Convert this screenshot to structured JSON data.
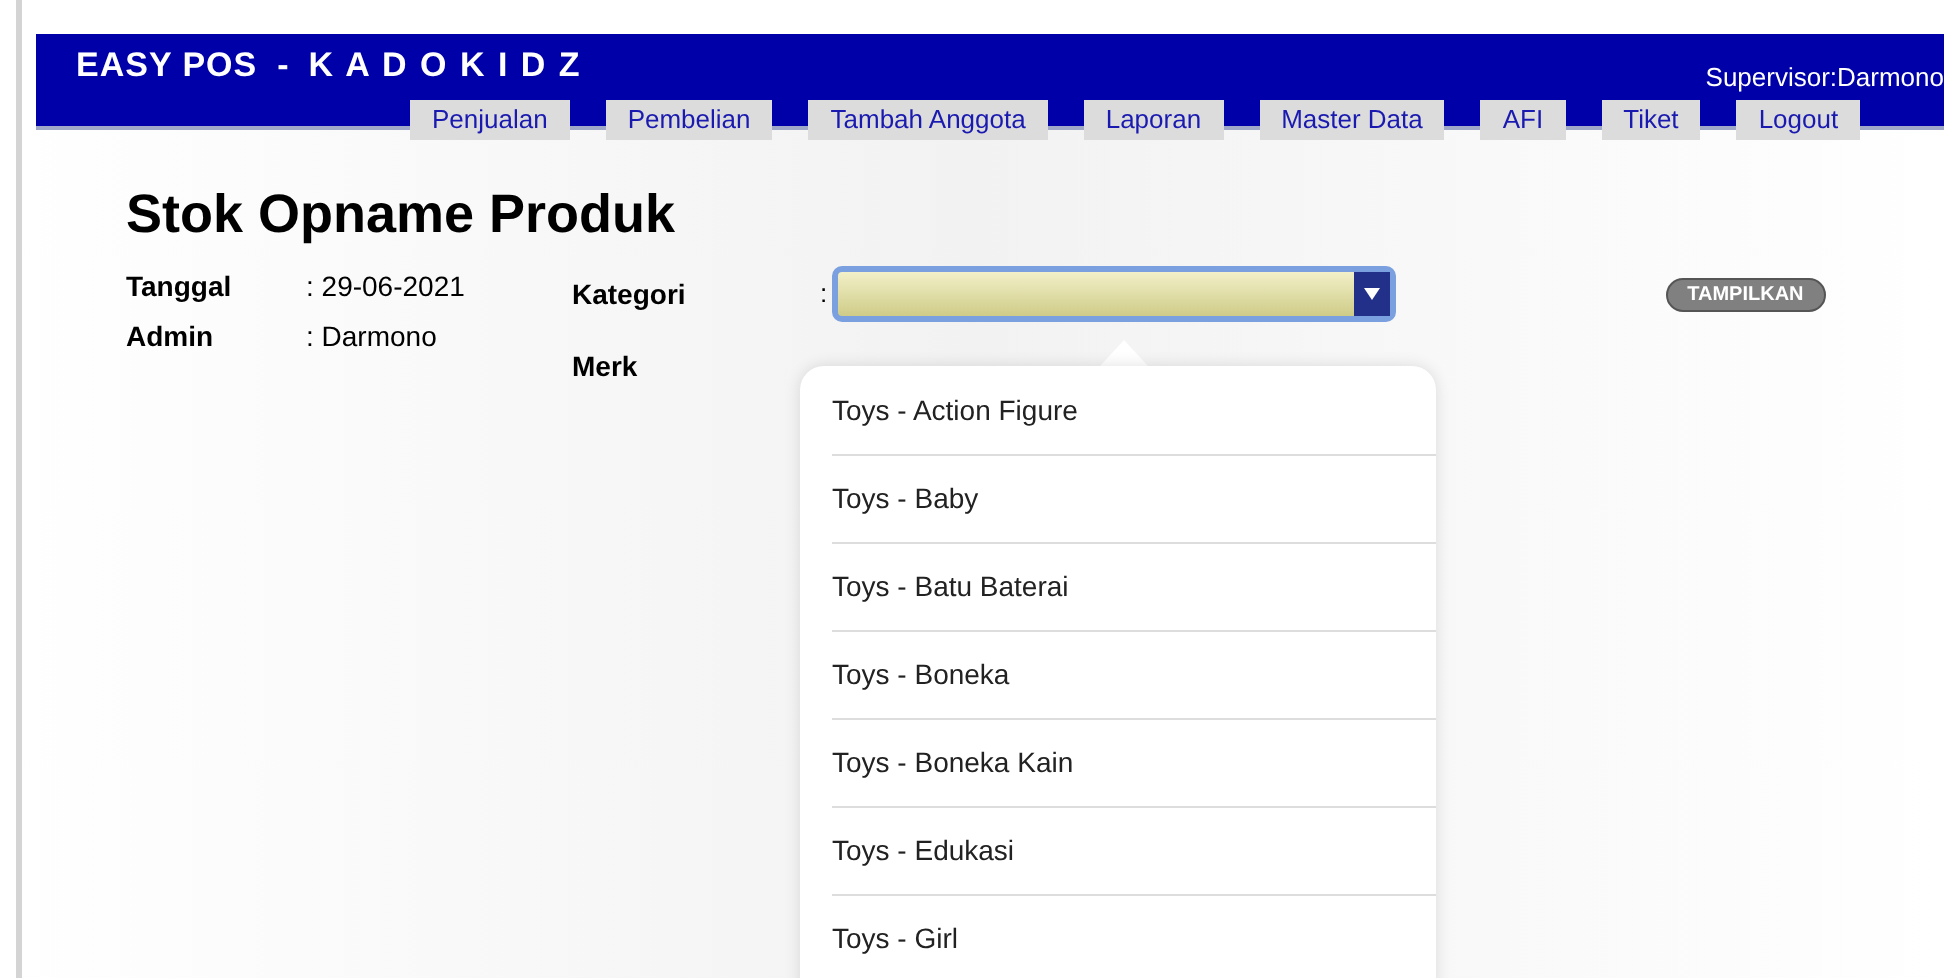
{
  "header": {
    "brand": "EASY POS",
    "brand_separator": "-",
    "brand_suffix": "K A D O K I D Z",
    "user": "Supervisor:Darmono",
    "tabs": [
      {
        "label": "Penjualan"
      },
      {
        "label": "Pembelian"
      },
      {
        "label": "Tambah Anggota"
      },
      {
        "label": "Laporan"
      },
      {
        "label": "Master Data"
      },
      {
        "label": "AFI"
      },
      {
        "label": "Tiket"
      },
      {
        "label": "Logout"
      }
    ]
  },
  "title": "Stok Opname Produk",
  "info": [
    {
      "label": "Tanggal",
      "value": ": 29-06-2021"
    },
    {
      "label": "Admin",
      "value": ": Darmono"
    }
  ],
  "filters": {
    "kategori_label": "Kategori",
    "separator": ":",
    "merk_label": "Merk",
    "button": "TAMPILKAN"
  },
  "dropdown": {
    "options": [
      {
        "label": "Toys - Action Figure"
      },
      {
        "label": "Toys - Baby"
      },
      {
        "label": "Toys - Batu Baterai"
      },
      {
        "label": "Toys - Boneka"
      },
      {
        "label": "Toys - Boneka Kain"
      },
      {
        "label": "Toys - Edukasi"
      },
      {
        "label": "Toys - Girl"
      }
    ]
  }
}
